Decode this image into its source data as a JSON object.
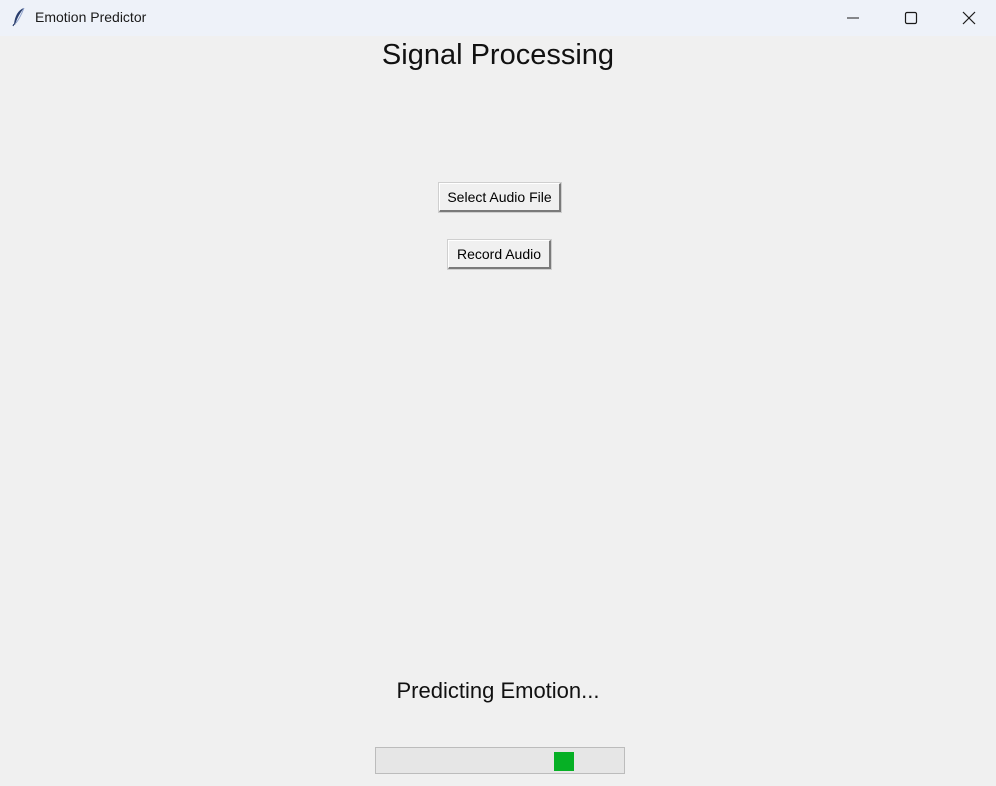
{
  "window": {
    "title": "Emotion Predictor",
    "icons": {
      "app": "feather-icon",
      "minimize": "minimize-icon",
      "maximize": "maximize-icon",
      "close": "close-icon"
    }
  },
  "main": {
    "heading": "Signal Processing",
    "select_audio_label": "Select Audio File",
    "record_audio_label": "Record Audio"
  },
  "status": {
    "text": "Predicting Emotion...",
    "progress_mode": "indeterminate",
    "progress_indicator_fraction": 0.78,
    "progress_color": "#06b025"
  }
}
